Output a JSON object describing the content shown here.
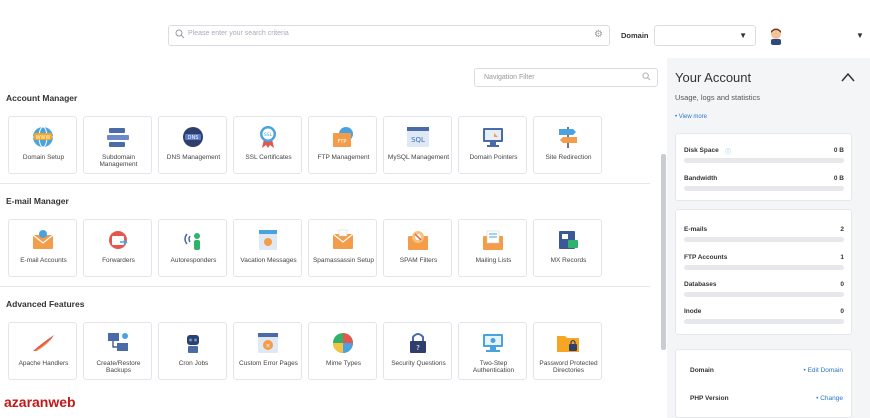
{
  "header": {
    "search_placeholder": "Please enter your search criteria",
    "domain_label": "Domain",
    "domain_value": ""
  },
  "nav_filter": {
    "placeholder": "Navigation Filter"
  },
  "sections": [
    {
      "title": "Account Manager",
      "items": [
        {
          "label": "Domain Setup",
          "icon": "globe-www-icon"
        },
        {
          "label": "Subdomain Management",
          "icon": "subdomain-www-icon"
        },
        {
          "label": "DNS Management",
          "icon": "dns-icon"
        },
        {
          "label": "SSL Certificates",
          "icon": "ssl-badge-icon"
        },
        {
          "label": "FTP Management",
          "icon": "ftp-folder-icon"
        },
        {
          "label": "MySQL Management",
          "icon": "sql-icon"
        },
        {
          "label": "Domain Pointers",
          "icon": "domain-pointer-icon"
        },
        {
          "label": "Site Redirection",
          "icon": "signpost-icon"
        }
      ]
    },
    {
      "title": "E-mail Manager",
      "items": [
        {
          "label": "E-mail Accounts",
          "icon": "email-accounts-icon"
        },
        {
          "label": "Forwarders",
          "icon": "forwarder-icon"
        },
        {
          "label": "Autoresponders",
          "icon": "autoresponder-icon"
        },
        {
          "label": "Vacation Messages",
          "icon": "vacation-icon"
        },
        {
          "label": "Spamassassin Setup",
          "icon": "spamassassin-icon"
        },
        {
          "label": "SPAM Filters",
          "icon": "spam-filter-icon"
        },
        {
          "label": "Mailing Lists",
          "icon": "mailing-list-icon"
        },
        {
          "label": "MX Records",
          "icon": "mx-records-icon"
        }
      ]
    },
    {
      "title": "Advanced Features",
      "items": [
        {
          "label": "Apache Handlers",
          "icon": "apache-feather-icon"
        },
        {
          "label": "Create/Restore Backups",
          "icon": "backup-icon"
        },
        {
          "label": "Cron Jobs",
          "icon": "cron-robot-icon"
        },
        {
          "label": "Custom Error Pages",
          "icon": "error-page-icon"
        },
        {
          "label": "Mime Types",
          "icon": "mime-types-icon"
        },
        {
          "label": "Security Questions",
          "icon": "security-lock-icon"
        },
        {
          "label": "Two-Step Authentication",
          "icon": "two-step-icon"
        },
        {
          "label": "Password Protected Directories",
          "icon": "protected-folder-icon"
        }
      ]
    }
  ],
  "sidebar": {
    "title": "Your Account",
    "subtitle": "Usage, logs and statistics",
    "view_more": "• View more",
    "usage": [
      {
        "name": "Disk Space",
        "value": "0 B",
        "fill": 0
      },
      {
        "name": "Bandwidth",
        "value": "0 B",
        "fill": 0
      }
    ],
    "counts": [
      {
        "name": "E-mails",
        "value": "2",
        "fill": 0
      },
      {
        "name": "FTP Accounts",
        "value": "1",
        "fill": 0
      },
      {
        "name": "Databases",
        "value": "0",
        "fill": 0
      },
      {
        "name": "Inode",
        "value": "0",
        "fill": 0
      }
    ],
    "info": [
      {
        "key": "Domain",
        "action": "• Edit Domain"
      },
      {
        "key": "PHP Version",
        "action": "• Change"
      }
    ]
  },
  "watermark": "azaranweb",
  "colors": {
    "accent": "#3b8ad8",
    "link": "#2a77c9",
    "watermark": "#c21818"
  }
}
